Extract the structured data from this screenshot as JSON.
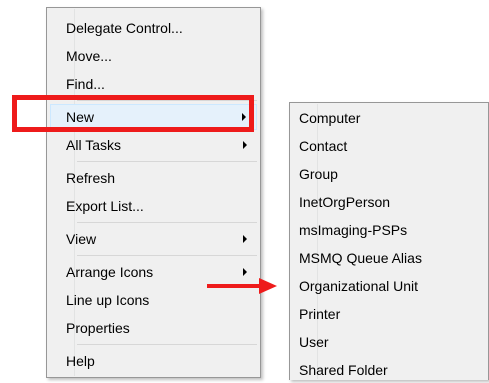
{
  "context_menu": {
    "items": [
      {
        "label": "Delegate Control..."
      },
      {
        "label": "Move..."
      },
      {
        "label": "Find..."
      },
      {
        "label": "New"
      },
      {
        "label": "All Tasks"
      },
      {
        "label": "Refresh"
      },
      {
        "label": "Export List..."
      },
      {
        "label": "View"
      },
      {
        "label": "Arrange Icons"
      },
      {
        "label": "Line up Icons"
      },
      {
        "label": "Properties"
      },
      {
        "label": "Help"
      }
    ]
  },
  "submenu_new": {
    "items": [
      {
        "label": "Computer"
      },
      {
        "label": "Contact"
      },
      {
        "label": "Group"
      },
      {
        "label": "InetOrgPerson"
      },
      {
        "label": "msImaging-PSPs"
      },
      {
        "label": "MSMQ Queue Alias"
      },
      {
        "label": "Organizational Unit"
      },
      {
        "label": "Printer"
      },
      {
        "label": "User"
      },
      {
        "label": "Shared Folder"
      }
    ]
  },
  "annotation": {
    "highlight_color": "#ee1b1b",
    "submenu_arrow_icon": "chevron-right-icon",
    "pointer_icon": "arrow-right-icon"
  }
}
